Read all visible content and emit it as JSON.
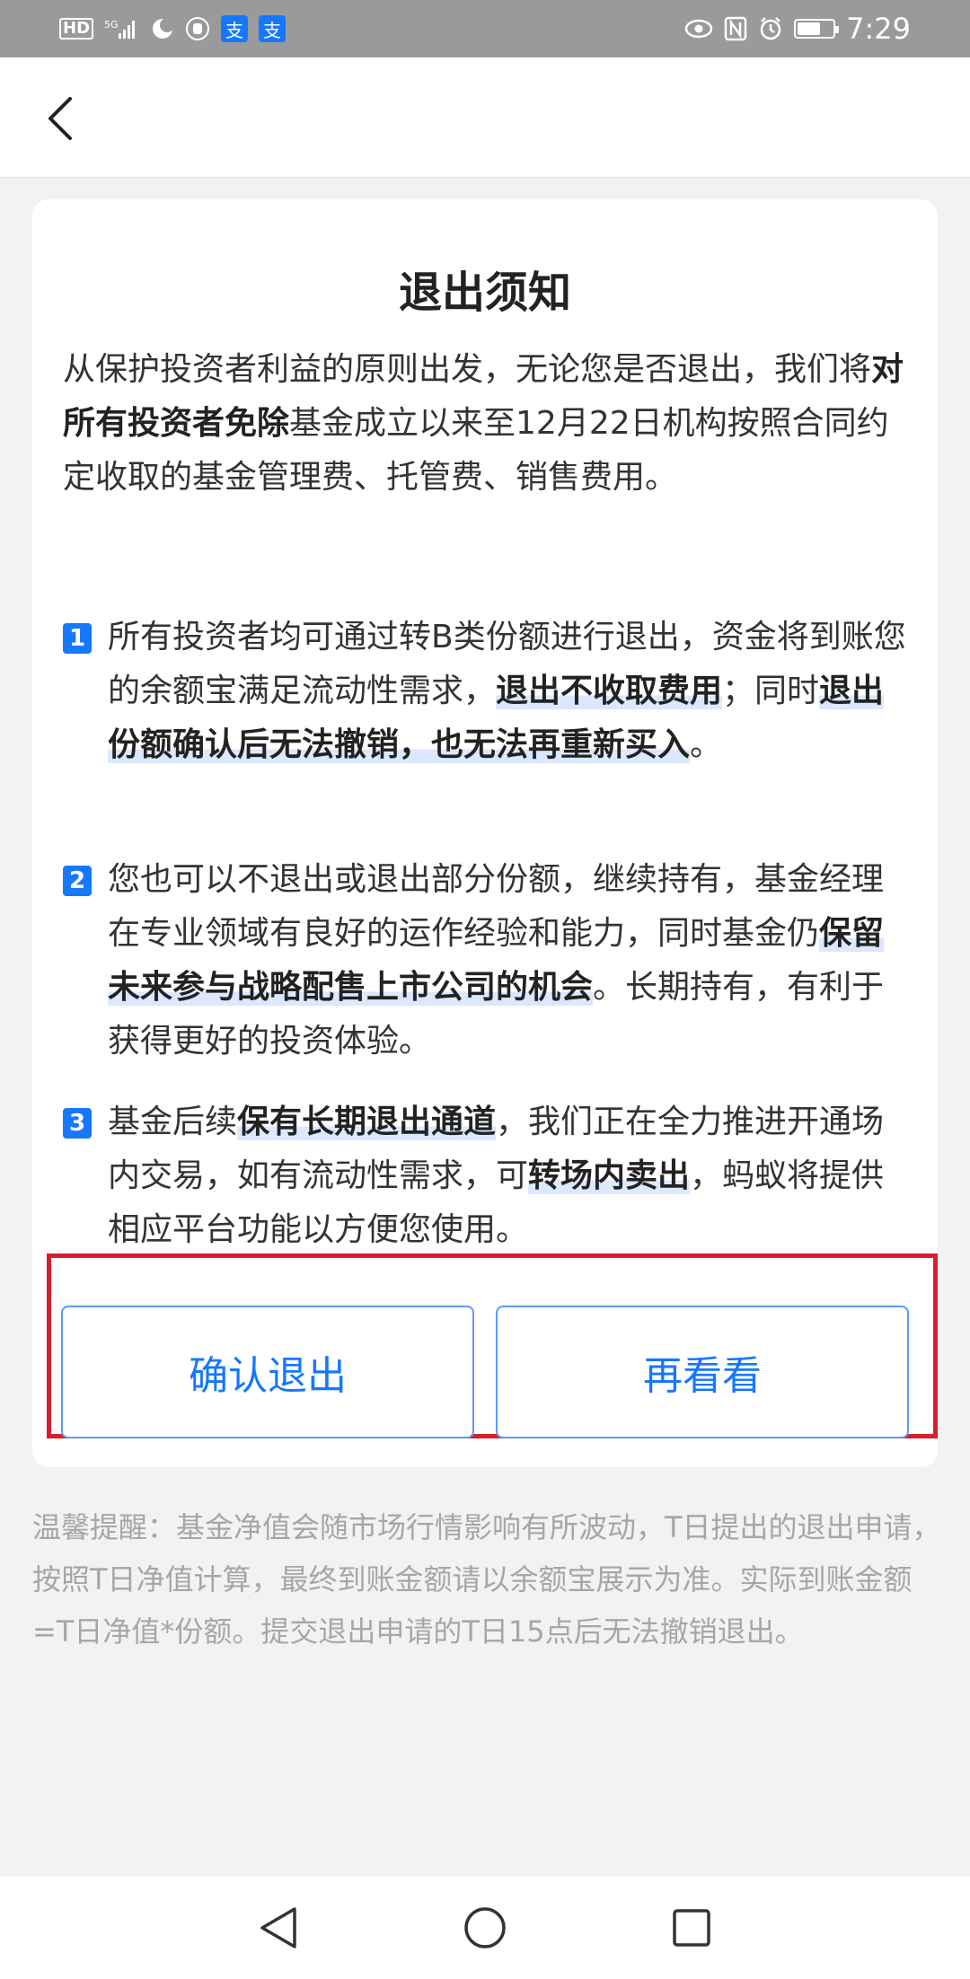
{
  "status_bar": {
    "left_icons": [
      "hd-icon",
      "5g-signal-icon",
      "moon-icon",
      "hand-icon",
      "alipay-icon",
      "alipay-icon"
    ],
    "hd_text": "HD",
    "alipay_glyph": "支",
    "right_icons": [
      "eye-icon",
      "nfc-icon",
      "alarm-icon",
      "battery-icon"
    ],
    "time": "7:29"
  },
  "header": {
    "back_icon": "chevron-left-icon"
  },
  "card": {
    "title": "退出须知",
    "intro": {
      "p1": "从保护投资者利益的原则出发，无论您是否退出，我们将",
      "p1_bold": "对所有投资者免除",
      "p1_rest": "基金成立以来至12月22日机构按照合同约定收取的基金管理费、托管费、销售费用。"
    },
    "items": [
      {
        "num": "1",
        "a": "所有投资者均可通过转B类份额进行退出，资金将到账您的余额宝满足流动性需求，",
        "b": "退出不收取费用",
        "c": "；同时",
        "d": "退出份额确认后无法撤销，也无法再重新买入",
        "e": "。"
      },
      {
        "num": "2",
        "a": "您也可以不退出或退出部分份额，继续持有，基金经理在专业领域有良好的运作经验和能力，同时基金仍",
        "b": "保留未来参与战略配售上市公司的机会",
        "c": "。长期持有，有利于获得更好的投资体验。"
      },
      {
        "num": "3",
        "a": "基金后续",
        "b": "保有长期退出通道",
        "c": "，我们正在全力推进开通场内交易，如有流动性需求，可",
        "d": "转场内卖出",
        "e": "，蚂蚁将提供相应平台功能以方便您使用。"
      }
    ],
    "buttons": {
      "confirm": "确认退出",
      "later": "再看看"
    },
    "accent_color": "#1677ff",
    "highlight_border_color": "#d81e2a"
  },
  "tip": "温馨提醒：基金净值会随市场行情影响有所波动，T日提出的退出申请，按照T日净值计算，最终到账金额请以余额宝展示为准。实际到账金额=T日净值*份额。提交退出申请的T日15点后无法撤销退出。",
  "nav_bar": {
    "icons": [
      "back-triangle-icon",
      "home-circle-icon",
      "recents-square-icon"
    ]
  }
}
